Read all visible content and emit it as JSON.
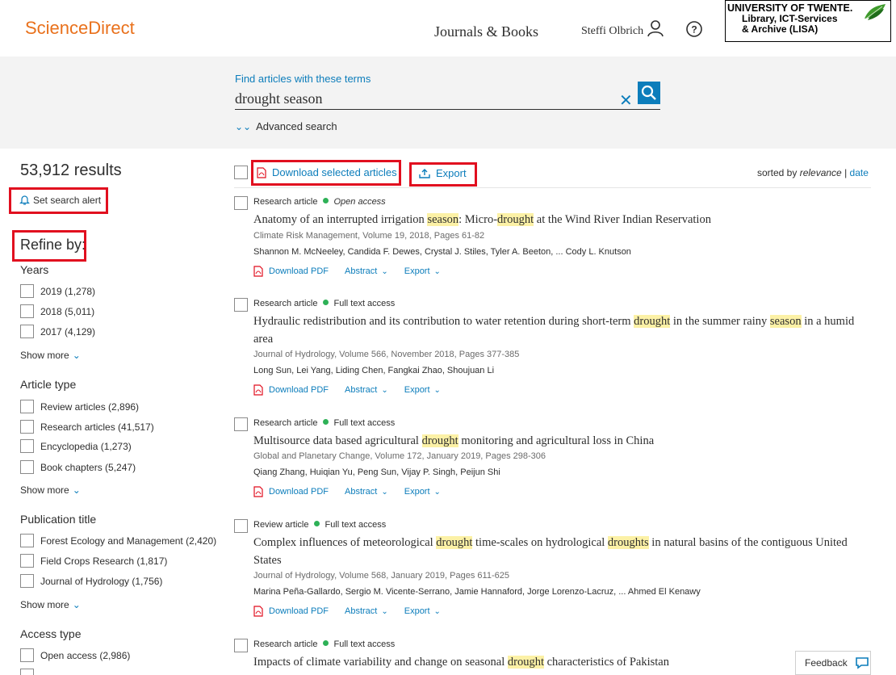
{
  "header": {
    "logo": "ScienceDirect",
    "journals_books": "Journals & Books",
    "user_name": "Steffi Olbrich",
    "university_lines": [
      "UNIVERSITY OF TWENTE.",
      "Library, ICT-Services",
      "& Archive (LISA)"
    ]
  },
  "search": {
    "label": "Find articles with these terms",
    "value": "drought season",
    "advanced": "Advanced search"
  },
  "sidebar": {
    "results_count": "53,912 results",
    "set_alert": "Set search alert",
    "refine_by": "Refine by:",
    "show_more": "Show more",
    "facets": [
      {
        "title": "Years",
        "options": [
          "2019 (1,278)",
          "2018 (5,011)",
          "2017 (4,129)"
        ]
      },
      {
        "title": "Article type",
        "options": [
          "Review articles (2,896)",
          "Research articles (41,517)",
          "Encyclopedia (1,273)",
          "Book chapters (5,247)"
        ]
      },
      {
        "title": "Publication title",
        "options": [
          "Forest Ecology and Management (2,420)",
          "Field Crops Research (1,817)",
          "Journal of Hydrology (1,756)"
        ]
      },
      {
        "title": "Access type",
        "options": [
          "Open access (2,986)"
        ]
      }
    ]
  },
  "toolbar": {
    "download_selected": "Download selected articles",
    "export": "Export",
    "sorted_by": "sorted by",
    "relevance": "relevance",
    "separator": "|",
    "date": "date"
  },
  "result_actions": {
    "download_pdf": "Download PDF",
    "abstract": "Abstract",
    "export": "Export"
  },
  "results": [
    {
      "type": "Research article",
      "access": "Open access",
      "title_parts": [
        "Anatomy of an interrupted irrigation ",
        "season",
        ": Micro-",
        "drought",
        " at the Wind River Indian Reservation"
      ],
      "source": "Climate Risk Management, Volume 19, 2018, Pages 61-82",
      "authors": "Shannon M. McNeeley, Candida F. Dewes, Crystal J. Stiles, Tyler A. Beeton, ... Cody L. Knutson"
    },
    {
      "type": "Research article",
      "access": "Full text access",
      "title_parts": [
        "Hydraulic redistribution and its contribution to water retention during short-term ",
        "drought",
        " in the summer rainy ",
        "season",
        " in a humid area"
      ],
      "source": "Journal of Hydrology, Volume 566, November 2018, Pages 377-385",
      "authors": "Long Sun, Lei Yang, Liding Chen, Fangkai Zhao, Shoujuan Li"
    },
    {
      "type": "Research article",
      "access": "Full text access",
      "title_parts": [
        "Multisource data based agricultural ",
        "drought",
        " monitoring and agricultural loss in China"
      ],
      "source": "Global and Planetary Change, Volume 172, January 2019, Pages 298-306",
      "authors": "Qiang Zhang, Huiqian Yu, Peng Sun, Vijay P. Singh, Peijun Shi"
    },
    {
      "type": "Review article",
      "access": "Full text access",
      "title_parts": [
        "Complex influences of meteorological ",
        "drought",
        " time-scales on hydrological ",
        "droughts",
        " in natural basins of the contiguous United States"
      ],
      "source": "Journal of Hydrology, Volume 568, January 2019, Pages 611-625",
      "authors": "Marina Peña-Gallardo, Sergio M. Vicente-Serrano, Jamie Hannaford, Jorge Lorenzo-Lacruz, ... Ahmed El Kenawy"
    },
    {
      "type": "Research article",
      "access": "Full text access",
      "title_parts": [
        "Impacts of climate variability and change on seasonal ",
        "drought",
        " characteristics of Pakistan"
      ]
    }
  ],
  "feedback": "Feedback",
  "colors": {
    "brand": "#e9711c",
    "link": "#0c7dbb",
    "highlight": "#fcf1a6",
    "annotation": "#e10f1f",
    "access_dot": "#2eb157"
  }
}
